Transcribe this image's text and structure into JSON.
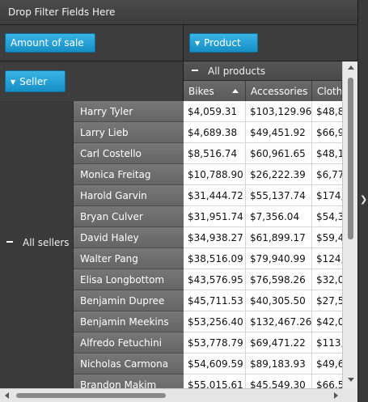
{
  "filter_zone": {
    "label": "Drop Filter Fields Here"
  },
  "data_fields": [
    {
      "label": "Amount of sale"
    }
  ],
  "column_fields": [
    {
      "label": "Product"
    }
  ],
  "row_fields": [
    {
      "label": "Seller"
    }
  ],
  "column_group": {
    "label": "All products"
  },
  "row_group": {
    "label": "All sellers"
  },
  "columns": [
    "Bikes",
    "Accessories",
    "Clothing"
  ],
  "sort": {
    "column": "Bikes",
    "direction": "ascending"
  },
  "rows": [
    {
      "seller": "Harry Tyler",
      "values": [
        "$4,059.31",
        "$103,129.96",
        "$48,8"
      ]
    },
    {
      "seller": "Larry Lieb",
      "values": [
        "$4,689.38",
        "$49,451.92",
        "$66,9"
      ]
    },
    {
      "seller": "Carl Costello",
      "values": [
        "$8,516.74",
        "$60,961.65",
        "$48,1"
      ]
    },
    {
      "seller": "Monica Freitag",
      "values": [
        "$10,788.90",
        "$26,222.39",
        "$6,77"
      ]
    },
    {
      "seller": "Harold Garvin",
      "values": [
        "$31,444.72",
        "$55,137.74",
        "$174,"
      ]
    },
    {
      "seller": "Bryan Culver",
      "values": [
        "$31,951.74",
        "$7,356.04",
        "$54,3"
      ]
    },
    {
      "seller": "David Haley",
      "values": [
        "$34,938.27",
        "$61,899.17",
        "$59,4"
      ]
    },
    {
      "seller": "Walter Pang",
      "values": [
        "$38,516.09",
        "$79,940.99",
        "$124,"
      ]
    },
    {
      "seller": "Elisa Longbottom",
      "values": [
        "$43,576.95",
        "$76,598.26",
        "$32,0"
      ]
    },
    {
      "seller": "Benjamin Dupree",
      "values": [
        "$45,711.53",
        "$40,305.50",
        "$27,5"
      ]
    },
    {
      "seller": "Benjamin Meekins",
      "values": [
        "$53,256.40",
        "$132,467.26",
        "$42,0"
      ]
    },
    {
      "seller": "Alfredo Fetuchini",
      "values": [
        "$53,778.79",
        "$69,471.22",
        "$113,"
      ]
    },
    {
      "seller": "Nicholas Carmona",
      "values": [
        "$54,609.59",
        "$89,183.93",
        "$49,6"
      ]
    },
    {
      "seller": "Brandon Makim",
      "values": [
        "$55,015.61",
        "$45,549.30",
        "$66,5"
      ]
    }
  ]
}
